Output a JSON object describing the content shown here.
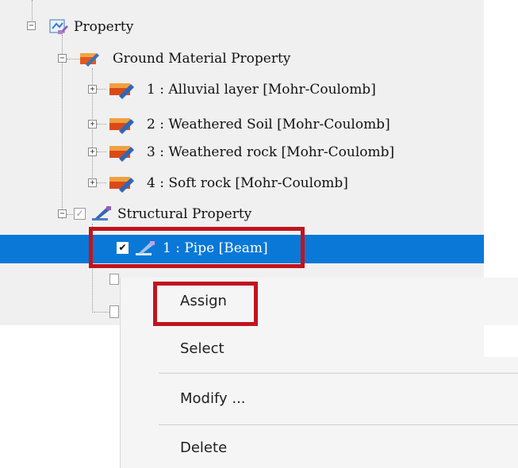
{
  "tree": {
    "root": {
      "label": "Property",
      "expander": "−",
      "icon": "property-icon"
    },
    "ground": {
      "label": "Ground Material Property",
      "expander": "−",
      "icon": "ground-material-icon"
    },
    "ground_items": [
      {
        "label": "1 : Alluvial layer [Mohr-Coulomb]",
        "expander": "+",
        "icon": "material-icon"
      },
      {
        "label": "2 : Weathered Soil [Mohr-Coulomb]",
        "expander": "+",
        "icon": "material-icon"
      },
      {
        "label": "3 : Weathered rock [Mohr-Coulomb]",
        "expander": "+",
        "icon": "material-icon"
      },
      {
        "label": "4 : Soft rock [Mohr-Coulomb]",
        "expander": "+",
        "icon": "material-icon"
      }
    ],
    "structural": {
      "label": "Structural Property",
      "expander": "−",
      "checkbox": "✓",
      "icon": "structural-property-icon"
    },
    "structural_items": [
      {
        "label": "1 : Pipe [Beam]",
        "checkbox": "✔",
        "checked": true,
        "selected": true,
        "icon": "beam-icon"
      }
    ]
  },
  "context_menu": {
    "items": [
      {
        "label": "Assign"
      },
      {
        "label": "Select"
      },
      {
        "label": "Modify ..."
      },
      {
        "label": "Delete"
      }
    ]
  },
  "colors": {
    "selection": "#0a78d7",
    "highlight_box": "#c0141e",
    "menu_bg": "#f5f5f5",
    "tree_bg": "#f0f0f0"
  }
}
